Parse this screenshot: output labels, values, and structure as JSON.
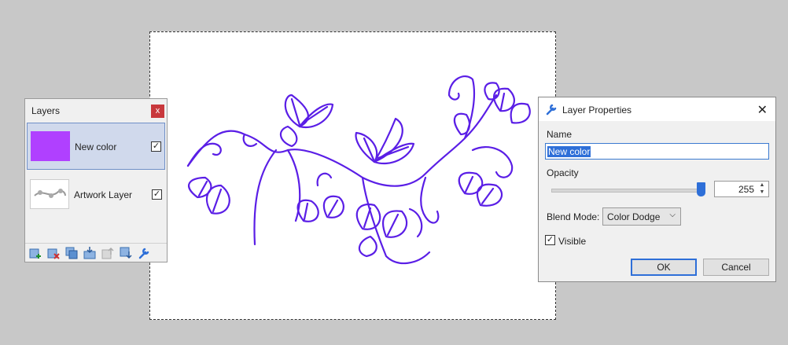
{
  "layers_panel": {
    "title": "Layers",
    "close_glyph": "x",
    "layers": [
      {
        "name": "New color",
        "visible": true,
        "selected": true,
        "thumb_color": "#b040ff"
      },
      {
        "name": "Artwork Layer",
        "visible": true,
        "selected": false
      }
    ],
    "tools": [
      "add-layer-icon",
      "delete-layer-icon",
      "duplicate-layer-icon",
      "merge-down-icon",
      "move-up-icon",
      "move-down-icon",
      "properties-icon"
    ]
  },
  "dialog": {
    "title": "Layer Properties",
    "name_label": "Name",
    "name_value": "New color",
    "opacity_label": "Opacity",
    "opacity_value": "255",
    "opacity_fraction": 1.0,
    "blend_label": "Blend Mode:",
    "blend_value": "Color Dodge",
    "visible_label": "Visible",
    "visible_checked": true,
    "ok_label": "OK",
    "cancel_label": "Cancel",
    "close_glyph": "✕"
  },
  "colors": {
    "artwork_stroke": "#5a1ee6",
    "selection_accent": "#2e6fd8",
    "close_red": "#c8383c"
  }
}
